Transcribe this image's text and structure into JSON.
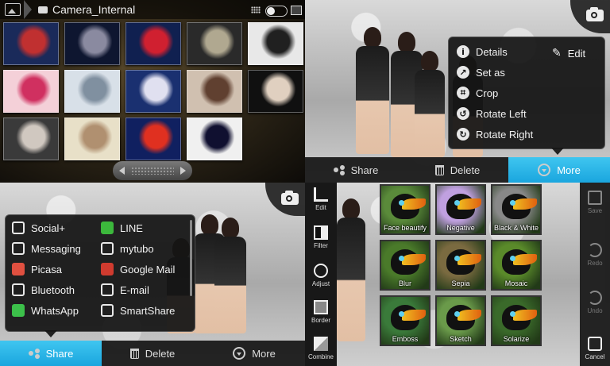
{
  "gallery": {
    "breadcrumb": "Camera_Internal",
    "thumbnails": [
      {
        "c1": "#1a2a5a",
        "c2": "#c03030"
      },
      {
        "c1": "#0e1630",
        "c2": "#8a8aa0"
      },
      {
        "c1": "#102050",
        "c2": "#d02030"
      },
      {
        "c1": "#2a2a2a",
        "c2": "#b0a890"
      },
      {
        "c1": "#e8e8e8",
        "c2": "#202020"
      },
      {
        "c1": "#f4d0d8",
        "c2": "#d03060"
      },
      {
        "c1": "#d8e0e8",
        "c2": "#8090a0"
      },
      {
        "c1": "#1a3070",
        "c2": "#e0e0f0"
      },
      {
        "c1": "#d0c0b0",
        "c2": "#604030"
      },
      {
        "c1": "#101010",
        "c2": "#e0d0c0"
      },
      {
        "c1": "#3a3a3a",
        "c2": "#d0c8c0"
      },
      {
        "c1": "#e8e0c8",
        "c2": "#b09070"
      },
      {
        "c1": "#102060",
        "c2": "#e03020"
      },
      {
        "c1": "#f0f0f0",
        "c2": "#101030"
      }
    ]
  },
  "more_menu": {
    "items": [
      {
        "label": "Details",
        "icon": "info-icon",
        "glyph": "i"
      },
      {
        "label": "Set as",
        "icon": "set-as-icon",
        "glyph": "↗"
      },
      {
        "label": "Crop",
        "icon": "crop-icon",
        "glyph": "⌗"
      },
      {
        "label": "Rotate Left",
        "icon": "rotate-left-icon",
        "glyph": "↺"
      },
      {
        "label": "Rotate Right",
        "icon": "rotate-right-icon",
        "glyph": "↻"
      }
    ],
    "edit_label": "Edit"
  },
  "action_bar_top": {
    "share": "Share",
    "delete": "Delete",
    "more": "More",
    "active": "more"
  },
  "share_menu": {
    "left": [
      {
        "label": "Social+",
        "icon": "social-plus-icon",
        "color": "#e8e8e8"
      },
      {
        "label": "Messaging",
        "icon": "messaging-icon",
        "color": "#e8e8e8"
      },
      {
        "label": "Picasa",
        "icon": "picasa-icon",
        "color": "#e05040"
      },
      {
        "label": "Bluetooth",
        "icon": "bluetooth-icon",
        "color": "#e8e8e8"
      },
      {
        "label": "WhatsApp",
        "icon": "whatsapp-icon",
        "color": "#3cc04a"
      }
    ],
    "right": [
      {
        "label": "LINE",
        "icon": "line-icon",
        "color": "#3cb83c"
      },
      {
        "label": "mytubo",
        "icon": "mytubo-icon",
        "color": "#e8e8e8"
      },
      {
        "label": "Google Mail",
        "icon": "gmail-icon",
        "color": "#d03b2f"
      },
      {
        "label": "E-mail",
        "icon": "email-icon",
        "color": "#e8e8e8"
      },
      {
        "label": "SmartShare",
        "icon": "smartshare-icon",
        "color": "#e8e8e8"
      }
    ]
  },
  "action_bar_bottom": {
    "share": "Share",
    "delete": "Delete",
    "more": "More",
    "active": "share"
  },
  "editor_tools": {
    "edit": "Edit",
    "filter": "Filter",
    "adjust": "Adjust",
    "border": "Border",
    "combine": "Combine"
  },
  "filters": [
    {
      "label": "Face beautify",
      "tint": "#5a8a3a"
    },
    {
      "label": "Negative",
      "tint": "#c0a0e0"
    },
    {
      "label": "Black & White",
      "tint": "#888888"
    },
    {
      "label": "Blur",
      "tint": "#4a7a2a"
    },
    {
      "label": "Sepia",
      "tint": "#7a6a40"
    },
    {
      "label": "Mosaic",
      "tint": "#5a8a2a"
    },
    {
      "label": "Emboss",
      "tint": "#3a7a3a"
    },
    {
      "label": "Sketch",
      "tint": "#6a9a4a"
    },
    {
      "label": "Solarize",
      "tint": "#3a6a2a"
    }
  ],
  "editor_actions": {
    "save": "Save",
    "redo": "Redo",
    "undo": "Undo",
    "cancel": "Cancel"
  },
  "colors": {
    "accent": "#1aa6de",
    "menu_bg": "#141414"
  }
}
